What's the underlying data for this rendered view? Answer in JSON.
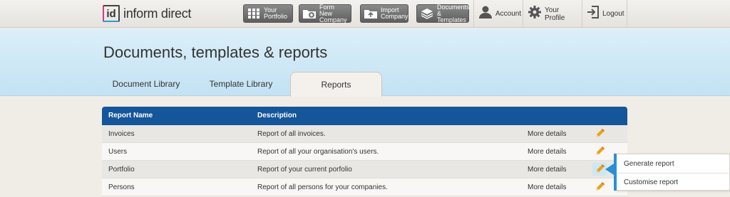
{
  "brand": {
    "logo_mark": "id",
    "name": "inform direct"
  },
  "topnav": {
    "buttons": [
      {
        "label": "Your\nPortfolio",
        "icon": "grid-icon"
      },
      {
        "label": "Form New\nCompany",
        "icon": "folder-plus-icon"
      },
      {
        "label": "Import\nCompany",
        "icon": "folder-upload-icon"
      },
      {
        "label": "Documents\n& Templates",
        "icon": "stack-icon"
      }
    ],
    "account": "Account",
    "profile": "Your Profile",
    "logout": "Logout"
  },
  "page": {
    "title": "Documents, templates & reports"
  },
  "tabs": [
    {
      "label": "Document Library",
      "active": false
    },
    {
      "label": "Template Library",
      "active": false
    },
    {
      "label": "Reports",
      "active": true
    }
  ],
  "table": {
    "headers": {
      "name": "Report Name",
      "description": "Description"
    },
    "rows": [
      {
        "name": "Invoices",
        "description": "Report of all invoices.",
        "more": "More details"
      },
      {
        "name": "Users",
        "description": "Report of all your organisation's users.",
        "more": "More details"
      },
      {
        "name": "Portfolio",
        "description": "Report of your current porfolio",
        "more": "More details"
      },
      {
        "name": "Persons",
        "description": "Report of all persons for your companies.",
        "more": "More details"
      }
    ]
  },
  "popup": {
    "items": [
      "Generate report",
      "Customise report"
    ]
  },
  "colors": {
    "header_blue": "#15559a",
    "accent": "#2b8fd6",
    "pencil": "#e8a317"
  }
}
